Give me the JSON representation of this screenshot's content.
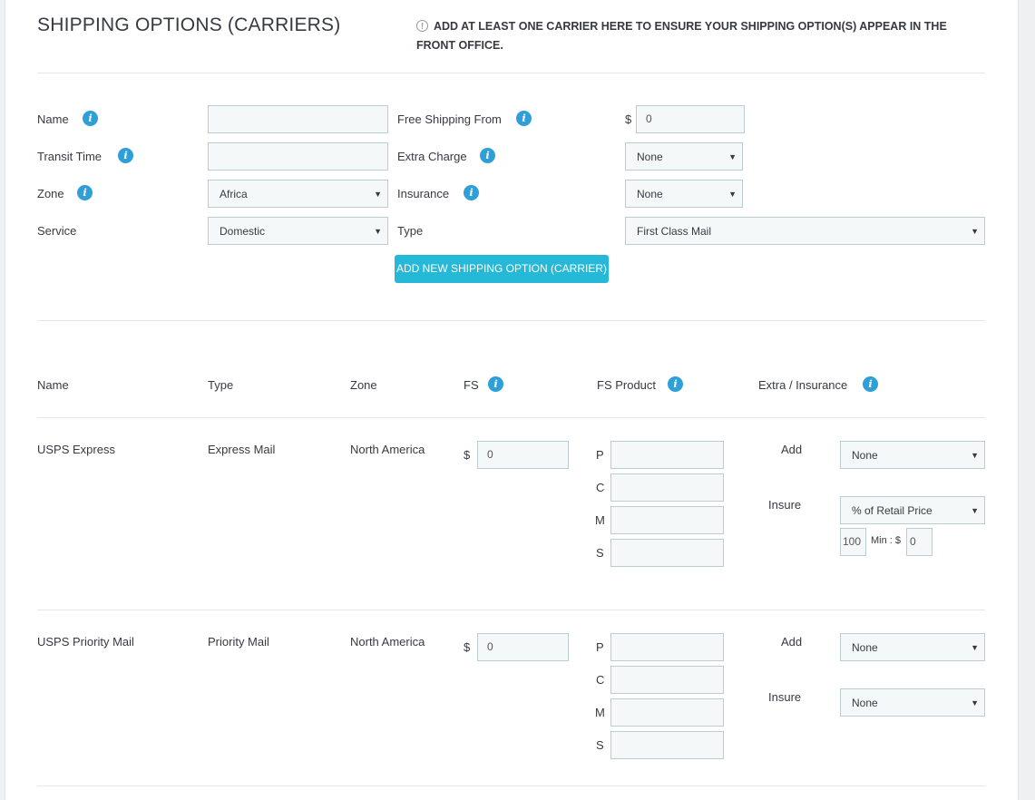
{
  "header": {
    "title": "SHIPPING OPTIONS (CARRIERS)",
    "notice": "ADD AT LEAST ONE CARRIER HERE TO ENSURE YOUR SHIPPING OPTION(S) APPEAR IN THE FRONT OFFICE."
  },
  "form": {
    "name_label": "Name",
    "transit_label": "Transit Time",
    "zone_label": "Zone",
    "zone_value": "Africa",
    "service_label": "Service",
    "service_value": "Domestic",
    "free_shipping_label": "Free Shipping From",
    "currency": "$",
    "free_shipping_value": "0",
    "extra_charge_label": "Extra Charge",
    "extra_charge_value": "None",
    "insurance_label": "Insurance",
    "insurance_value": "None",
    "type_label": "Type",
    "type_value": "First Class Mail",
    "add_button": "ADD NEW SHIPPING OPTION (CARRIER)"
  },
  "table": {
    "headers": {
      "name": "Name",
      "type": "Type",
      "zone": "Zone",
      "fs": "FS",
      "fs_product": "FS Product",
      "extra_insurance": "Extra / Insurance"
    },
    "product_letters": [
      "P",
      "C",
      "M",
      "S"
    ],
    "add_label": "Add",
    "insure_label": "Insure",
    "min_label": "Min : $",
    "rows": [
      {
        "name": "USPS Express",
        "type": "Express Mail",
        "zone": "North America",
        "fs_value": "0",
        "add_value": "None",
        "insure_value": "% of Retail Price",
        "insure_percent": "100",
        "insure_min": "0"
      },
      {
        "name": "USPS Priority Mail",
        "type": "Priority Mail",
        "zone": "North America",
        "fs_value": "0",
        "add_value": "None",
        "insure_value": "None"
      }
    ]
  },
  "icons": {
    "info": "info-icon",
    "notice": "exclamation-circle-icon",
    "caret": "caret-down-icon",
    "cursor": "mouse-cursor-icon"
  },
  "colors": {
    "accent": "#25b9d7",
    "info": "#2e9fd8",
    "text": "#363a41",
    "input_bg": "#f5f8f9",
    "input_border": "#bbcdd2"
  }
}
